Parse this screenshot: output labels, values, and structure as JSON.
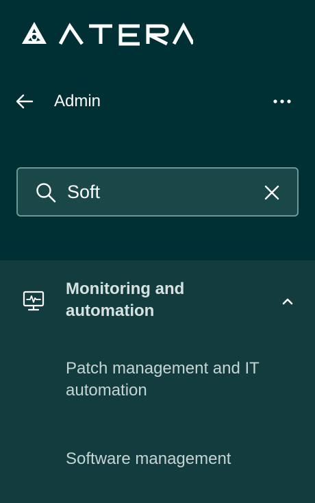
{
  "brand": {
    "name": "ATERA",
    "logo_icon": "atera-logo-icon"
  },
  "header": {
    "back_icon": "arrow-left-icon",
    "title": "Admin",
    "more_icon": "more-horizontal-icon"
  },
  "search": {
    "icon": "search-icon",
    "value": "Soft",
    "placeholder": "",
    "clear_icon": "close-icon"
  },
  "menu": {
    "section": {
      "icon": "monitor-icon",
      "title": "Monitoring and automation",
      "expanded": true,
      "chevron_icon": "chevron-up-icon",
      "items": [
        {
          "label": "Patch management and IT automation"
        },
        {
          "label": "Software management"
        }
      ]
    }
  },
  "colors": {
    "background": "#003034",
    "panel": "#123c3e",
    "search_bg": "#1a4848",
    "search_border": "#6f9696",
    "text": "#ffffff",
    "muted_text": "#c6d4d4"
  }
}
